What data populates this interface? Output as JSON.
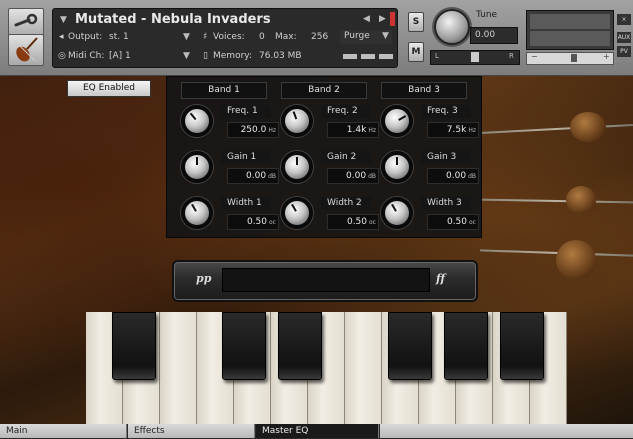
{
  "instrument": {
    "name": "Mutated - Nebula Invaders",
    "output_label": "Output:",
    "output_value": "st. 1",
    "midi_label": "Midi Ch:",
    "midi_value": "[A] 1",
    "voices_label": "Voices:",
    "voices_value": "0",
    "max_label": "Max:",
    "max_value": "256",
    "purge_label": "Purge",
    "memory_label": "Memory:",
    "memory_value": "76.03 MB"
  },
  "side_controls": {
    "solo_label": "S",
    "mute_label": "M",
    "tune_label": "Tune",
    "tune_value": "0.00",
    "pan_left": "L",
    "pan_right": "R",
    "aux_label": "AUX",
    "pv_label": "PV"
  },
  "eq": {
    "enabled_label": "EQ Enabled",
    "bands": [
      {
        "title": "Band 1",
        "freq_label": "Freq. 1",
        "freq_value": "250.0",
        "freq_unit": "Hz",
        "gain_label": "Gain 1",
        "gain_value": "0.00",
        "gain_unit": "dB",
        "width_label": "Width 1",
        "width_value": "0.50",
        "width_unit": "oc"
      },
      {
        "title": "Band 2",
        "freq_label": "Freq. 2",
        "freq_value": "1.4k",
        "freq_unit": "Hz",
        "gain_label": "Gain 2",
        "gain_value": "0.00",
        "gain_unit": "dB",
        "width_label": "Width 2",
        "width_value": "0.50",
        "width_unit": "oc"
      },
      {
        "title": "Band 3",
        "freq_label": "Freq. 3",
        "freq_value": "7.5k",
        "freq_unit": "Hz",
        "gain_label": "Gain 3",
        "gain_value": "0.00",
        "gain_unit": "dB",
        "width_label": "Width 3",
        "width_value": "0.50",
        "width_unit": "oc"
      }
    ]
  },
  "velocity": {
    "low_label": "pp",
    "high_label": "ff"
  },
  "tabs": [
    {
      "label": "Main"
    },
    {
      "label": "Effects"
    },
    {
      "label": "Master EQ"
    }
  ],
  "colors": {
    "header": "#8e8e8e",
    "panel": "#161616",
    "accent": "#e8e8e8"
  },
  "icons": [
    "wrench-icon",
    "violin-icon",
    "speaker-icon",
    "midi-icon",
    "voices-icon",
    "memory-icon"
  ]
}
